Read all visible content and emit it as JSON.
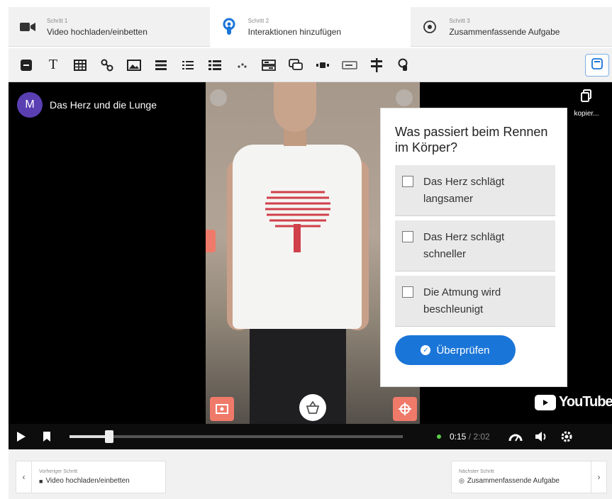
{
  "steps": [
    {
      "small": "Schritt 1",
      "title": "Video hochladen/einbetten",
      "icon": "video-camera-icon"
    },
    {
      "small": "Schritt 2",
      "title": "Interaktionen hinzufügen",
      "icon": "touch-icon"
    },
    {
      "small": "Schritt 3",
      "title": "Zusammenfassende Aufgabe",
      "icon": "check-circle-icon"
    }
  ],
  "toolbar": {
    "icons": [
      "stop-icon",
      "text-icon",
      "table-icon",
      "link-icon",
      "image-icon",
      "list-icon",
      "ordered-list-icon",
      "unordered-list-icon",
      "sort-icon",
      "drag-drop-icon",
      "speech-bubble-icon",
      "audio-icon",
      "field-icon",
      "crossroads-icon",
      "hotspot-icon"
    ],
    "text_glyph": "T"
  },
  "video": {
    "channel_initial": "M",
    "title": "Das Herz und die Lunge",
    "copy_label": "kopier...",
    "youtube_label": "YouTube",
    "current_time": "0:15",
    "duration": "2:02",
    "progress_fraction": 0.12
  },
  "question": {
    "text": "Was passiert beim Rennen im Körper?",
    "options": [
      "Das Herz schlägt langsamer",
      "Das Herz schlägt schneller",
      "Die Atmung wird beschleunigt"
    ],
    "check_label": "Überprüfen"
  },
  "bottom_nav": {
    "prev_small": "Vorheriger Schritt",
    "prev_label": "Video hochladen/einbetten",
    "next_small": "Nächster Schritt",
    "next_label": "Zusammenfassende Aufgabe"
  },
  "colors": {
    "accent": "#1a75d8",
    "hotspot": "#f07a6a",
    "avatar": "#5a3fb3"
  }
}
